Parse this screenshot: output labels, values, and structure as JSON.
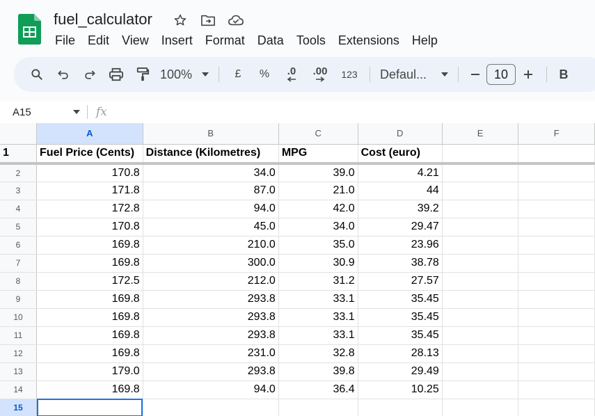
{
  "doc": {
    "title": "fuel_calculator"
  },
  "menu": [
    "File",
    "Edit",
    "View",
    "Insert",
    "Format",
    "Data",
    "Tools",
    "Extensions",
    "Help"
  ],
  "toolbar": {
    "zoom": "100%",
    "currency": "£",
    "percent": "%",
    "dec_decrease": ".0",
    "dec_increase": ".00",
    "number_format": "123",
    "font": "Defaul...",
    "font_size": "10",
    "bold": "B"
  },
  "formula_bar": {
    "cell_ref": "A15",
    "fx": "fx"
  },
  "grid": {
    "columns": [
      "A",
      "B",
      "C",
      "D",
      "E",
      "F"
    ],
    "header_row": [
      "Fuel Price (Cents)",
      "Distance (Kilometres)",
      "MPG",
      "Cost (euro)",
      "",
      ""
    ],
    "rows": [
      [
        "170.8",
        "34.0",
        "39.0",
        "4.21"
      ],
      [
        "171.8",
        "87.0",
        "21.0",
        "44"
      ],
      [
        "172.8",
        "94.0",
        "42.0",
        "39.2"
      ],
      [
        "170.8",
        "45.0",
        "34.0",
        "29.47"
      ],
      [
        "169.8",
        "210.0",
        "35.0",
        "23.96"
      ],
      [
        "169.8",
        "300.0",
        "30.9",
        "38.78"
      ],
      [
        "172.5",
        "212.0",
        "31.2",
        "27.57"
      ],
      [
        "169.8",
        "293.8",
        "33.1",
        "35.45"
      ],
      [
        "169.8",
        "293.8",
        "33.1",
        "35.45"
      ],
      [
        "169.8",
        "293.8",
        "33.1",
        "35.45"
      ],
      [
        "169.8",
        "231.0",
        "32.8",
        "28.13"
      ],
      [
        "179.0",
        "293.8",
        "39.8",
        "29.49"
      ],
      [
        "169.8",
        "94.0",
        "36.4",
        "10.25"
      ]
    ],
    "row_numbers": [
      "1",
      "2",
      "3",
      "4",
      "5",
      "6",
      "7",
      "8",
      "9",
      "10",
      "11",
      "12",
      "13",
      "14",
      "15"
    ]
  },
  "colors": {
    "accent": "#1a73e8",
    "sheets_green": "#0f9d58",
    "selected_header": "#d3e3fd"
  }
}
